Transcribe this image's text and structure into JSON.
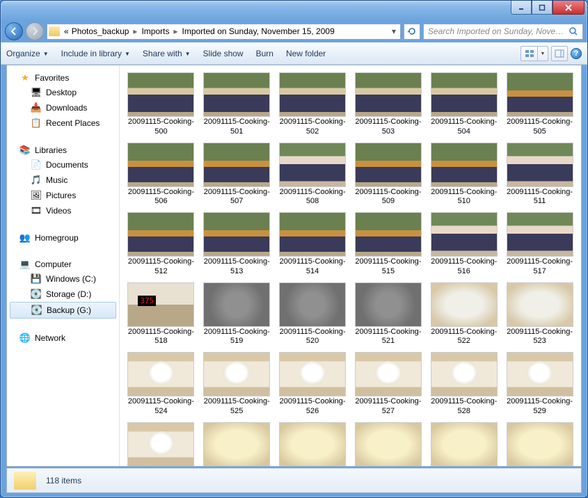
{
  "window": {
    "controls": {
      "minimize": "minimize",
      "maximize": "maximize",
      "close": "close"
    }
  },
  "breadcrumb": {
    "prefix": "«",
    "items": [
      "Photos_backup",
      "Imports",
      "Imported on Sunday, November 15, 2009"
    ]
  },
  "search": {
    "placeholder": "Search Imported on Sunday, Novembe..."
  },
  "toolbar": {
    "organize": "Organize",
    "include": "Include in library",
    "share": "Share with",
    "slideshow": "Slide show",
    "burn": "Burn",
    "newfolder": "New folder"
  },
  "sidebar": {
    "favorites": {
      "label": "Favorites",
      "items": [
        {
          "label": "Desktop",
          "icon": "desktop"
        },
        {
          "label": "Downloads",
          "icon": "downloads"
        },
        {
          "label": "Recent Places",
          "icon": "recent"
        }
      ]
    },
    "libraries": {
      "label": "Libraries",
      "items": [
        {
          "label": "Documents",
          "icon": "doc"
        },
        {
          "label": "Music",
          "icon": "music"
        },
        {
          "label": "Pictures",
          "icon": "pic"
        },
        {
          "label": "Videos",
          "icon": "vid"
        }
      ]
    },
    "homegroup": {
      "label": "Homegroup"
    },
    "computer": {
      "label": "Computer",
      "items": [
        {
          "label": "Windows (C:)",
          "icon": "drive",
          "selected": false
        },
        {
          "label": "Storage (D:)",
          "icon": "drive",
          "selected": false
        },
        {
          "label": "Backup (G:)",
          "icon": "drive",
          "selected": true
        }
      ]
    },
    "network": {
      "label": "Network"
    }
  },
  "thumbnails": [
    {
      "label": "20091115-Cooking-500",
      "style": "th-a"
    },
    {
      "label": "20091115-Cooking-501",
      "style": "th-a"
    },
    {
      "label": "20091115-Cooking-502",
      "style": "th-a"
    },
    {
      "label": "20091115-Cooking-503",
      "style": "th-a"
    },
    {
      "label": "20091115-Cooking-504",
      "style": "th-a"
    },
    {
      "label": "20091115-Cooking-505",
      "style": "th-b"
    },
    {
      "label": "20091115-Cooking-506",
      "style": "th-b"
    },
    {
      "label": "20091115-Cooking-507",
      "style": "th-b"
    },
    {
      "label": "20091115-Cooking-508",
      "style": "th-c"
    },
    {
      "label": "20091115-Cooking-509",
      "style": "th-b"
    },
    {
      "label": "20091115-Cooking-510",
      "style": "th-b"
    },
    {
      "label": "20091115-Cooking-511",
      "style": "th-c"
    },
    {
      "label": "20091115-Cooking-512",
      "style": "th-b"
    },
    {
      "label": "20091115-Cooking-513",
      "style": "th-b"
    },
    {
      "label": "20091115-Cooking-514",
      "style": "th-b"
    },
    {
      "label": "20091115-Cooking-515",
      "style": "th-b"
    },
    {
      "label": "20091115-Cooking-516",
      "style": "th-c"
    },
    {
      "label": "20091115-Cooking-517",
      "style": "th-c"
    },
    {
      "label": "20091115-Cooking-518",
      "style": "th-d"
    },
    {
      "label": "20091115-Cooking-519",
      "style": "th-e"
    },
    {
      "label": "20091115-Cooking-520",
      "style": "th-e"
    },
    {
      "label": "20091115-Cooking-521",
      "style": "th-e"
    },
    {
      "label": "20091115-Cooking-522",
      "style": "th-f"
    },
    {
      "label": "20091115-Cooking-523",
      "style": "th-f"
    },
    {
      "label": "20091115-Cooking-524",
      "style": "th-g"
    },
    {
      "label": "20091115-Cooking-525",
      "style": "th-g"
    },
    {
      "label": "20091115-Cooking-526",
      "style": "th-g"
    },
    {
      "label": "20091115-Cooking-527",
      "style": "th-g"
    },
    {
      "label": "20091115-Cooking-528",
      "style": "th-g"
    },
    {
      "label": "20091115-Cooking-529",
      "style": "th-g"
    },
    {
      "label": "",
      "style": "th-g"
    },
    {
      "label": "",
      "style": "th-h"
    },
    {
      "label": "",
      "style": "th-h"
    },
    {
      "label": "",
      "style": "th-h"
    },
    {
      "label": "",
      "style": "th-h"
    },
    {
      "label": "",
      "style": "th-h"
    }
  ],
  "status": {
    "count": "118 items"
  }
}
